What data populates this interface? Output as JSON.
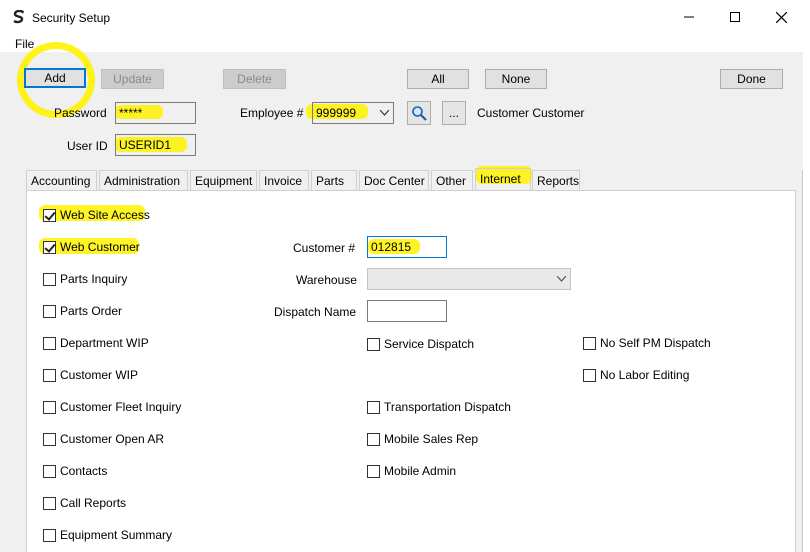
{
  "window": {
    "title": "Security Setup"
  },
  "menu": {
    "file": "File"
  },
  "toolbar": {
    "add": "Add",
    "update": "Update",
    "delete": "Delete",
    "all": "All",
    "none": "None",
    "done": "Done"
  },
  "form": {
    "password_label": "Password",
    "password_value": "*****",
    "userid_label": "User ID",
    "userid_value": "USERID1",
    "employee_label": "Employee #",
    "employee_value": "999999",
    "employee_name": "Customer Customer",
    "lookup_more": "..."
  },
  "tabs": [
    {
      "label": "Accounting"
    },
    {
      "label": "Administration"
    },
    {
      "label": "Equipment"
    },
    {
      "label": "Invoice"
    },
    {
      "label": "Parts"
    },
    {
      "label": "Doc Center"
    },
    {
      "label": "Other"
    },
    {
      "label": "Internet"
    },
    {
      "label": "Reports"
    }
  ],
  "active_tab": "Internet",
  "internet": {
    "left_checks": [
      {
        "label": "Web Site Access",
        "checked": true
      },
      {
        "label": "Web Customer",
        "checked": true
      },
      {
        "label": "Parts Inquiry",
        "checked": false
      },
      {
        "label": "Parts Order",
        "checked": false
      },
      {
        "label": "Department WIP",
        "checked": false
      },
      {
        "label": "Customer WIP",
        "checked": false
      },
      {
        "label": "Customer Fleet Inquiry",
        "checked": false
      },
      {
        "label": "Customer Open AR",
        "checked": false
      },
      {
        "label": "Contacts",
        "checked": false
      },
      {
        "label": "Call Reports",
        "checked": false
      },
      {
        "label": "Equipment Summary",
        "checked": false
      }
    ],
    "customer_label": "Customer #",
    "customer_value": "012815",
    "warehouse_label": "Warehouse",
    "warehouse_value": "",
    "dispatch_label": "Dispatch Name",
    "dispatch_value": "",
    "mid_checks": [
      {
        "label": "Service Dispatch",
        "checked": false
      },
      {
        "label": "Transportation Dispatch",
        "checked": false
      },
      {
        "label": "Mobile Sales Rep",
        "checked": false
      },
      {
        "label": "Mobile Admin",
        "checked": false
      }
    ],
    "right_checks": [
      {
        "label": "No Self PM Dispatch",
        "checked": false
      },
      {
        "label": "No Labor Editing",
        "checked": false
      }
    ]
  },
  "colors": {
    "highlight": "#fff200",
    "focus": "#0078d7"
  }
}
